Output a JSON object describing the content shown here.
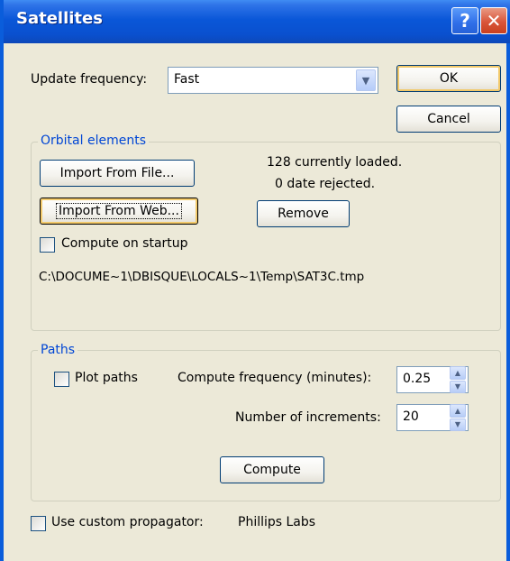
{
  "window": {
    "title": "Satellites",
    "help_glyph": "?",
    "close_glyph": "✕"
  },
  "update": {
    "label": "Update frequency:",
    "selected": "Fast"
  },
  "buttons": {
    "ok": "OK",
    "cancel": "Cancel"
  },
  "orbital": {
    "group_title": "Orbital elements",
    "import_file": "Import From File...",
    "import_web": "Import From Web...",
    "loaded_text": "128 currently loaded.",
    "rejected_text": "0 date rejected.",
    "remove": "Remove",
    "compute_on_startup": "Compute on startup",
    "compute_on_startup_checked": false,
    "path": "C:\\DOCUME~1\\DBISQUE\\LOCALS~1\\Temp\\SAT3C.tmp"
  },
  "paths": {
    "group_title": "Paths",
    "plot_paths": "Plot paths",
    "plot_paths_checked": false,
    "compute_freq_label": "Compute frequency (minutes):",
    "compute_freq_value": "0.25",
    "increments_label": "Number of increments:",
    "increments_value": "20",
    "compute": "Compute"
  },
  "propagator": {
    "label": "Use custom propagator:",
    "checked": false,
    "value": "Phillips Labs"
  },
  "icons": {
    "dropdown": "chevron-down-icon",
    "spin_up": "triangle-up-icon",
    "spin_down": "triangle-down-icon"
  },
  "colors": {
    "titlebar": "#0A57D8",
    "dialog_bg": "#ECE9D8",
    "group_title": "#0046D5",
    "close_button": "#D9553A"
  }
}
